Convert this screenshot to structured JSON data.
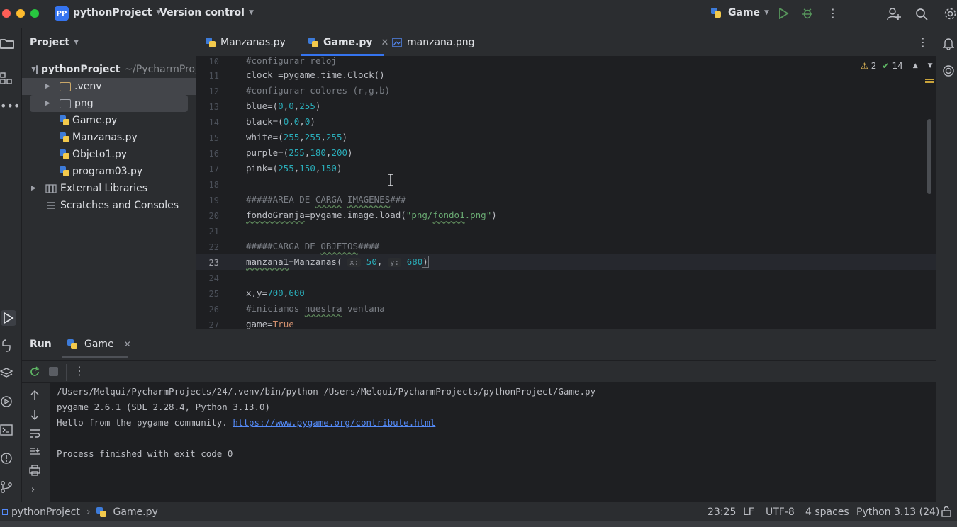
{
  "window": {
    "project_badge": "PP",
    "project_name": "pythonProject",
    "version_control": "Version control",
    "run_config": "Game"
  },
  "project_panel": {
    "title": "Project",
    "items": [
      {
        "label": "pythonProject",
        "sub": "~/PycharmProje",
        "kind": "folder"
      },
      {
        "label": ".venv",
        "kind": "folder"
      },
      {
        "label": "png",
        "kind": "folder"
      },
      {
        "label": "Game.py",
        "kind": "python"
      },
      {
        "label": "Manzanas.py",
        "kind": "python"
      },
      {
        "label": "Objeto1.py",
        "kind": "python"
      },
      {
        "label": "program03.py",
        "kind": "python"
      },
      {
        "label": "External Libraries",
        "kind": "library"
      },
      {
        "label": "Scratches and Consoles",
        "kind": "scratch"
      }
    ]
  },
  "editor_tabs": [
    {
      "label": "Manzanas.py",
      "active": false
    },
    {
      "label": "Game.py",
      "active": true
    },
    {
      "label": "manzana.png",
      "active": false
    }
  ],
  "inspections": {
    "warnings": "2",
    "ok": "14"
  },
  "editor": {
    "line_numbers": [
      "10",
      "11",
      "12",
      "13",
      "14",
      "15",
      "16",
      "17",
      "18",
      "19",
      "20",
      "21",
      "22",
      "23",
      "24",
      "25",
      "26",
      "27"
    ],
    "current_line": "23",
    "lines": {
      "l10": "#configurar reloj",
      "l11": "clock =pygame.time.Clock()",
      "l12": "#configurar colores (r,g,b)",
      "l13a": "blue=(",
      "l13b": "0",
      "l13c": "0",
      "l13d": "255",
      "l14a": "black=(",
      "l14b": "0",
      "l14c": "0",
      "l14d": "0",
      "l15a": "white=(",
      "l15b": "255",
      "l15c": "255",
      "l15d": "255",
      "l16a": "purple=(",
      "l16b": "255",
      "l16c": "180",
      "l16d": "200",
      "l17a": "pink=(",
      "l17b": "255",
      "l17c": "150",
      "l17d": "150",
      "l19a": "#####AREA DE ",
      "l19b": "CARGA",
      "l19c": "IMAGENES",
      "l19d": "###",
      "l20a": "fondoGranja",
      "l20b": "=pygame.image.load(",
      "l20c": "\"png/",
      "l20d": "fondo1",
      "l20e": ".png\"",
      "l20f": ")",
      "l22a": "#####CARGA DE ",
      "l22b": "OBJETOS",
      "l22c": "####",
      "l23a": "manzana1",
      "l23b": "=Manzanas(",
      "l23c": "x:",
      "l23d": "50",
      "l23e": "y:",
      "l23f": "680",
      "l23g": ")",
      "l25a": "x,y=",
      "l25b": "700",
      "l25c": "600",
      "l26a": "#iniciamos ",
      "l26b": "nuestra",
      "l26c": " ventana",
      "l27a": "game=",
      "l27b": "True"
    }
  },
  "run_panel": {
    "title": "Run",
    "tab": "Game",
    "console": {
      "line1": "/Users/Melqui/PycharmProjects/24/.venv/bin/python /Users/Melqui/PycharmProjects/pythonProject/Game.py",
      "line2": "pygame 2.6.1 (SDL 2.28.4, Python 3.13.0)",
      "line3": "Hello from the pygame community. ",
      "line3_link": "https://www.pygame.org/contribute.html",
      "line4": "Process finished with exit code 0"
    }
  },
  "statusbar": {
    "breadcrumb_project": "pythonProject",
    "breadcrumb_file": "Game.py",
    "position": "23:25",
    "line_sep": "LF",
    "encoding": "UTF-8",
    "indent": "4 spaces",
    "interpreter": "Python 3.13 (24)"
  },
  "colors": {
    "accent": "#3574f0",
    "number": "#2aacb8",
    "keyword": "#cf8e6d",
    "string": "#6aab73",
    "comment": "#7a7e85"
  }
}
